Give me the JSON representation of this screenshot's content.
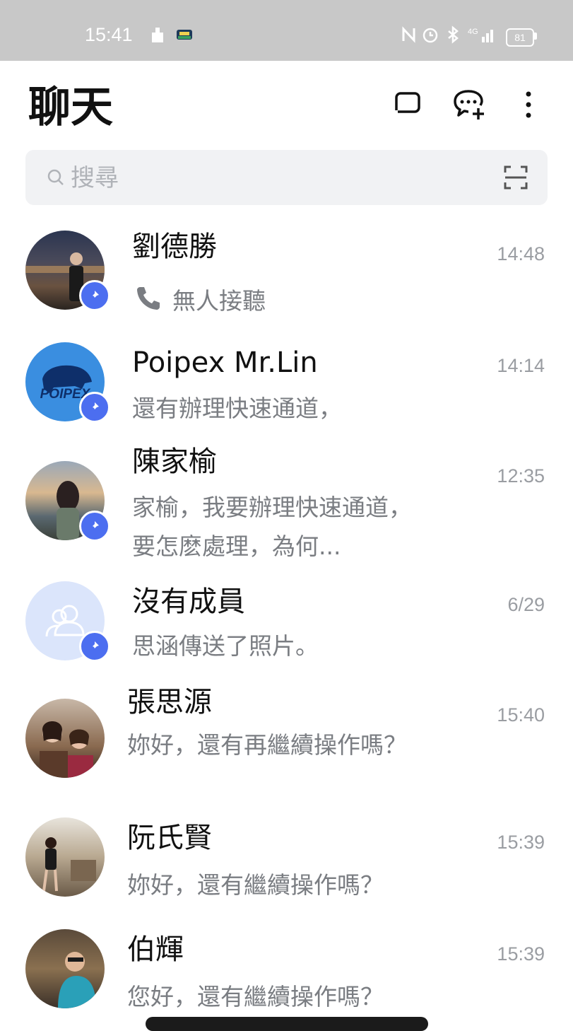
{
  "status_bar": {
    "time": "15:41",
    "battery": "81"
  },
  "header": {
    "title": "聊天"
  },
  "search": {
    "placeholder": "搜尋"
  },
  "chats": [
    {
      "name": "劉德勝",
      "preview": "無人接聽",
      "time": "14:48",
      "pinned": true
    },
    {
      "name": "Poipex  Mr.Lin",
      "preview": "還有辦理快速通道，",
      "time": "14:14",
      "pinned": true,
      "avatar_text": "POIPEX"
    },
    {
      "name": "陳家榆",
      "preview": "家榆，我要辦理快速通道，要怎麽處理，為何...",
      "time": "12:35",
      "pinned": true
    },
    {
      "name": "沒有成員",
      "preview": "思涵傳送了照片。",
      "time": "6/29",
      "pinned": true
    },
    {
      "name": "張思源",
      "preview": "妳好，還有再繼續操作嗎？",
      "time": "15:40",
      "pinned": false
    },
    {
      "name": "阮氏賢",
      "preview": "妳好，還有繼續操作嗎？",
      "time": "15:39",
      "pinned": false
    },
    {
      "name": "伯輝",
      "preview": "您好，還有繼續操作嗎？",
      "time": "15:39",
      "pinned": false
    }
  ],
  "colors": {
    "accent": "#4c6ef0",
    "status_bar": "#c8c8c8",
    "search_bg": "#f1f2f4"
  }
}
